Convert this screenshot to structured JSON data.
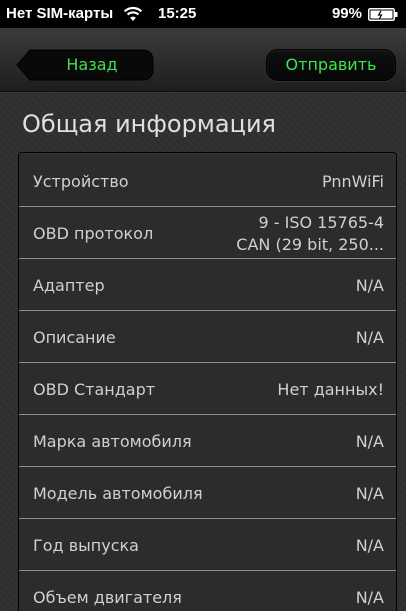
{
  "status_bar": {
    "carrier": "Нет SIM-карты",
    "time": "15:25",
    "battery": "99%",
    "wifi_icon": "wifi-icon",
    "battery_icon": "battery-icon"
  },
  "nav": {
    "back_label": "Назад",
    "send_label": "Отправить",
    "accent_color": "#3fe24f"
  },
  "section": {
    "title": "Общая информация"
  },
  "rows": [
    {
      "label": "Устройство",
      "value": "PnnWiFi"
    },
    {
      "label": "OBD протокол",
      "value_line1": "9 - ISO 15765-4",
      "value_line2": "CAN (29 bit, 250..."
    },
    {
      "label": "Адаптер",
      "value": "N/A"
    },
    {
      "label": "Описание",
      "value": "N/A"
    },
    {
      "label": "OBD Стандарт",
      "value": "Нет данных!"
    },
    {
      "label": "Марка автомобиля",
      "value": "N/A"
    },
    {
      "label": "Модель автомобиля",
      "value": "N/A"
    },
    {
      "label": "Год выпуска",
      "value": "N/A"
    },
    {
      "label": "Объем двигателя",
      "value": "N/A"
    }
  ]
}
